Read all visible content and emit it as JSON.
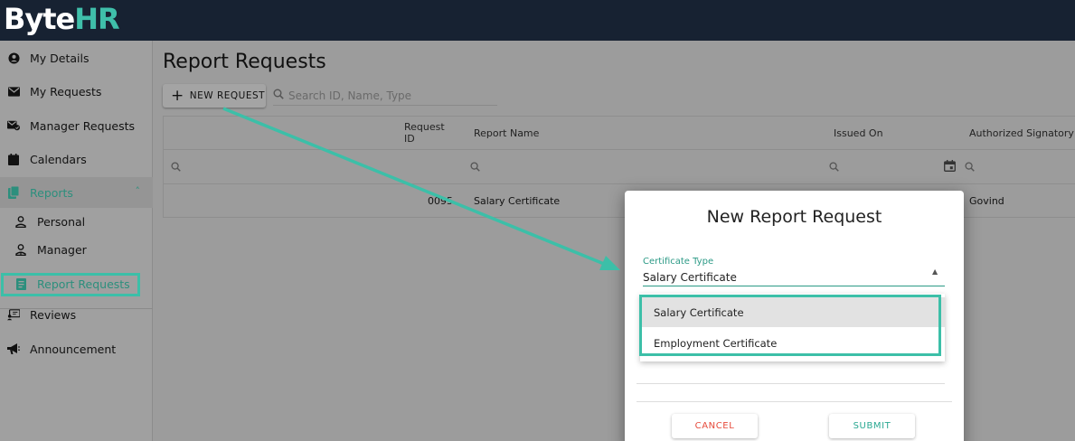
{
  "app": {
    "logo_left": "B",
    "logo_mid": "yte",
    "logo_right": "HR"
  },
  "sidebar": {
    "items": [
      {
        "label": "My Details",
        "icon": "account-circle-icon"
      },
      {
        "label": "My Requests",
        "icon": "mail-icon"
      },
      {
        "label": "Manager Requests",
        "icon": "mail-check-icon"
      },
      {
        "label": "Calendars",
        "icon": "calendar-icon"
      },
      {
        "label": "Reports",
        "icon": "file-copy-icon"
      },
      {
        "label": "Personal",
        "icon": "person-outline-icon"
      },
      {
        "label": "Manager",
        "icon": "manager-outline-icon"
      },
      {
        "label": "Report Requests",
        "icon": "report-document-icon"
      },
      {
        "label": "Reviews",
        "icon": "review-screen-icon"
      },
      {
        "label": "Announcement",
        "icon": "megaphone-icon"
      }
    ]
  },
  "main": {
    "title": "Report Requests",
    "new_request_label": "NEW REQUEST",
    "search_placeholder": "Search ID, Name, Type",
    "columns": [
      "Request ID",
      "Report Name",
      "Issued On",
      "Authorized Signatory"
    ],
    "rows": [
      {
        "request_id": "0095",
        "report_name": "Salary Certificate",
        "issued_on": "",
        "signatory": "Govind"
      }
    ]
  },
  "modal": {
    "title": "New Report Request",
    "field_label": "Certificate Type",
    "field_value": "Salary Certificate",
    "options": [
      "Salary Certificate",
      "Employment Certificate"
    ],
    "cancel_label": "CANCEL",
    "submit_label": "SUBMIT"
  },
  "colors": {
    "accent": "#3cbfa8",
    "topbar": "#172232",
    "cancel": "#e64a3b"
  }
}
